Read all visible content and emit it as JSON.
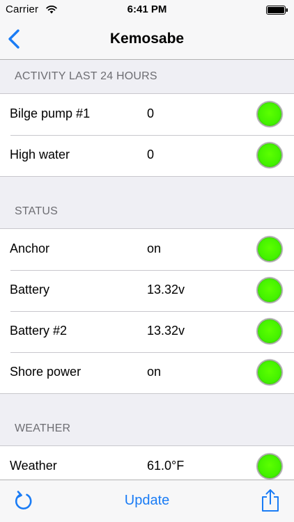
{
  "status_bar": {
    "carrier": "Carrier",
    "time": "6:41 PM"
  },
  "nav": {
    "title": "Kemosabe",
    "back_icon": "chevron-left-icon"
  },
  "sections": [
    {
      "header": "ACTIVITY LAST 24 HOURS",
      "rows": [
        {
          "label": "Bilge pump #1",
          "value": "0",
          "status": "green"
        },
        {
          "label": "High water",
          "value": "0",
          "status": "green"
        }
      ]
    },
    {
      "header": "STATUS",
      "rows": [
        {
          "label": "Anchor",
          "value": "on",
          "status": "green"
        },
        {
          "label": "Battery",
          "value": "13.32v",
          "status": "green"
        },
        {
          "label": "Battery #2",
          "value": "13.32v",
          "status": "green"
        },
        {
          "label": "Shore power",
          "value": "on",
          "status": "green"
        }
      ]
    },
    {
      "header": "WEATHER",
      "rows": [
        {
          "label": "Weather",
          "value": "61.0°F",
          "status": "green"
        }
      ]
    }
  ],
  "toolbar": {
    "update_label": "Update",
    "refresh_icon": "refresh-icon",
    "share_icon": "share-icon"
  },
  "colors": {
    "accent": "#1a7cf5",
    "status_green": "#44f200",
    "section_header_text": "#6d6d72",
    "background": "#efeff4"
  }
}
